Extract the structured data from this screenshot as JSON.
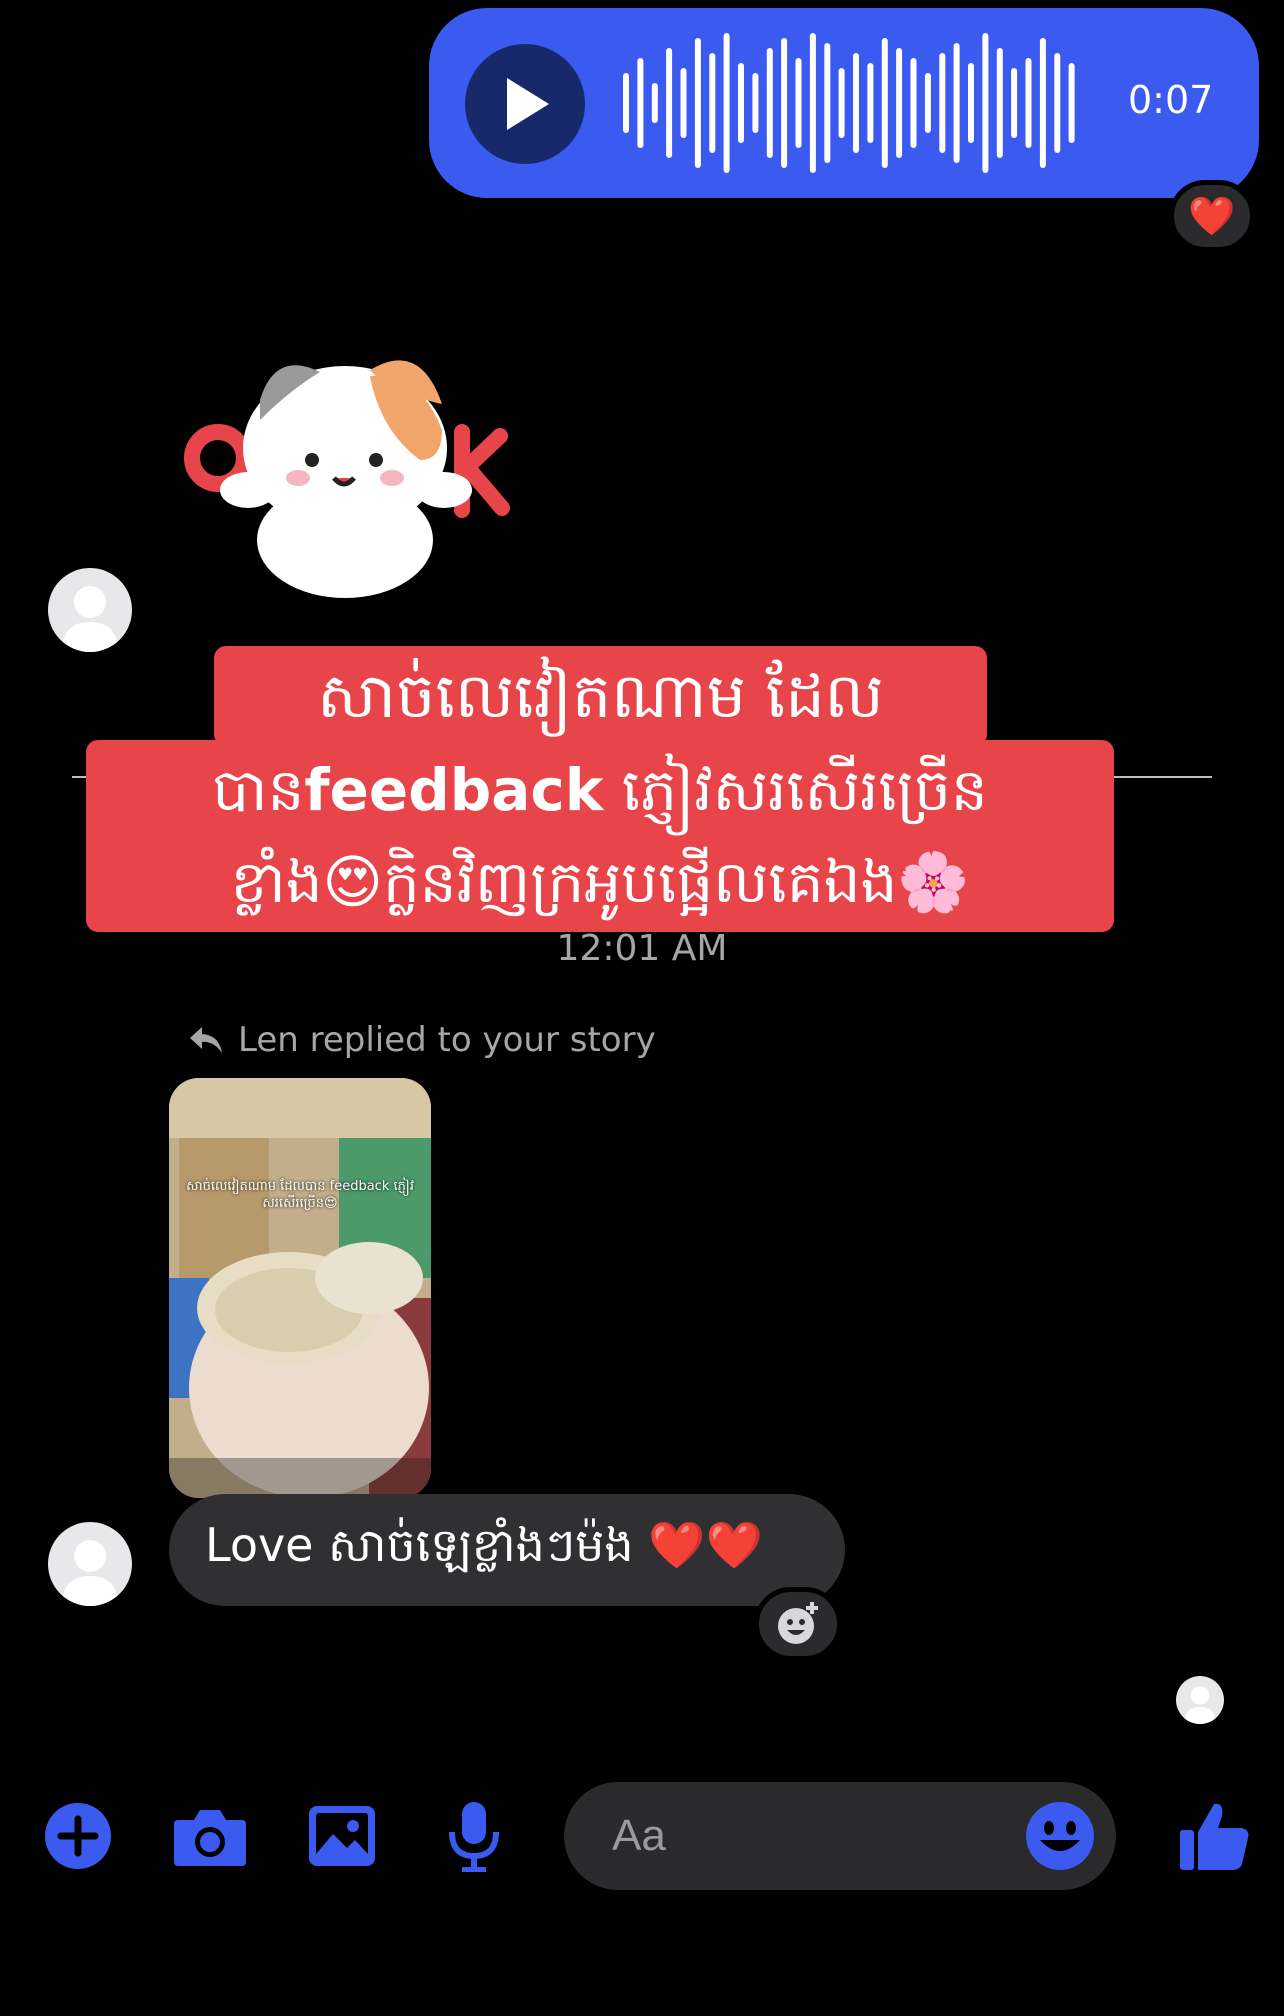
{
  "colors": {
    "accent": "#3b5bf0",
    "caption_background": "#e8454b",
    "incoming_bubble": "#303032",
    "background": "#000000"
  },
  "voice_message": {
    "duration": "0:07",
    "reaction": "❤️",
    "play_icon": "play-icon"
  },
  "sticker": {
    "icon": "ok-cat-sticker"
  },
  "caption": {
    "line1": "សាច់លេវៀតណាម ដែល",
    "line2_prefix": "បាន",
    "line2_bold": "feedback",
    "line2_suffix": " ភ្ញៀវសរសើរច្រើន",
    "line3": "ខ្លាំង😍ក្លិនវិញក្រអូបផ្អើលគេឯង🌸"
  },
  "timestamp": "12:01 AM",
  "story_reply": {
    "label": "Len replied to your story",
    "story_caption": "សាច់លេវៀតណាម ដែលបាន feedback ភ្ញៀវសរសើរច្រើន😍",
    "message": "Love សាច់ឡេខ្លាំងៗម៉ង ❤️❤️"
  },
  "composer": {
    "placeholder": "Aa",
    "icons": [
      "plus-icon",
      "camera-icon",
      "image-icon",
      "microphone-icon",
      "emoji-icon",
      "thumbs-up-icon"
    ]
  }
}
